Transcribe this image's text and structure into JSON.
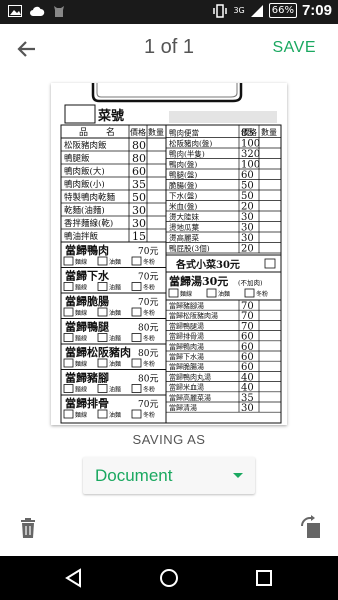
{
  "status_bar": {
    "network": "3G",
    "battery": "66%",
    "time": "7:09"
  },
  "app_bar": {
    "page_indicator": "1 of 1",
    "save_label": "SAVE"
  },
  "document": {
    "header_title": "菜號",
    "left_table": {
      "headers": [
        "品　　名",
        "價格",
        "數量"
      ],
      "rows": [
        [
          "松阪豬肉飯",
          "80"
        ],
        [
          "鴨腿飯",
          "80"
        ],
        [
          "鴨肉飯(大)",
          "60"
        ],
        [
          "鴨肉飯(小)",
          "35"
        ],
        [
          "特製鴨肉乾麵",
          "50"
        ],
        [
          "乾麵(油麵)",
          "30"
        ],
        [
          "香拌麵線(乾)",
          "30"
        ],
        [
          "鴨油拌飯",
          "15"
        ]
      ]
    },
    "right_table": {
      "headers": [
        "品　　名",
        "價格",
        "數量"
      ],
      "rows": [
        [
          "鴨肉便當",
          "85"
        ],
        [
          "松阪豬肉(盤)",
          "100"
        ],
        [
          "鴨肉(半隻)",
          "320"
        ],
        [
          "鴨肉(盤)",
          "100"
        ],
        [
          "鴨腿(盤)",
          "60"
        ],
        [
          "脆腸(盤)",
          "50"
        ],
        [
          "下水(盤)",
          "50"
        ],
        [
          "米血(盤)",
          "20"
        ],
        [
          "燙大陸妹",
          "30"
        ],
        [
          "燙地瓜葉",
          "30"
        ],
        [
          "燙高麗菜",
          "30"
        ],
        [
          "鴨屁股(3個)",
          "20"
        ]
      ]
    },
    "noodle_options": [
      "麵線",
      "油麵",
      "冬粉"
    ],
    "noodle_dishes": [
      {
        "name": "當歸鴨肉",
        "price": "70元"
      },
      {
        "name": "當歸下水",
        "price": "70元"
      },
      {
        "name": "當歸脆腸",
        "price": "70元"
      },
      {
        "name": "當歸鴨腿",
        "price": "80元"
      },
      {
        "name": "當歸松阪豬肉",
        "price": "80元"
      },
      {
        "name": "當歸豬腳",
        "price": "80元"
      },
      {
        "name": "當歸排骨",
        "price": "70元"
      }
    ],
    "side_dish": "各式小菜30元",
    "soup_title": "當歸湯30元",
    "soup_note": "(不加肉)",
    "soups": [
      [
        "當歸豬腳湯",
        "70"
      ],
      [
        "當歸松阪豬肉湯",
        "70"
      ],
      [
        "當歸鴨腿湯",
        "70"
      ],
      [
        "當歸排骨湯",
        "60"
      ],
      [
        "當歸鴨肉湯",
        "60"
      ],
      [
        "當歸下水湯",
        "60"
      ],
      [
        "當歸脆腸湯",
        "60"
      ],
      [
        "當歸鴨肉丸湯",
        "40"
      ],
      [
        "當歸米血湯",
        "40"
      ],
      [
        "當歸高麗菜湯",
        "35"
      ],
      [
        "當歸清湯",
        "30"
      ]
    ]
  },
  "saving_as": {
    "label": "SAVING AS",
    "value": "Document"
  },
  "colors": {
    "accent": "#1aa860",
    "status_bar": "#1a1a1a",
    "nav_bar": "#000000"
  }
}
